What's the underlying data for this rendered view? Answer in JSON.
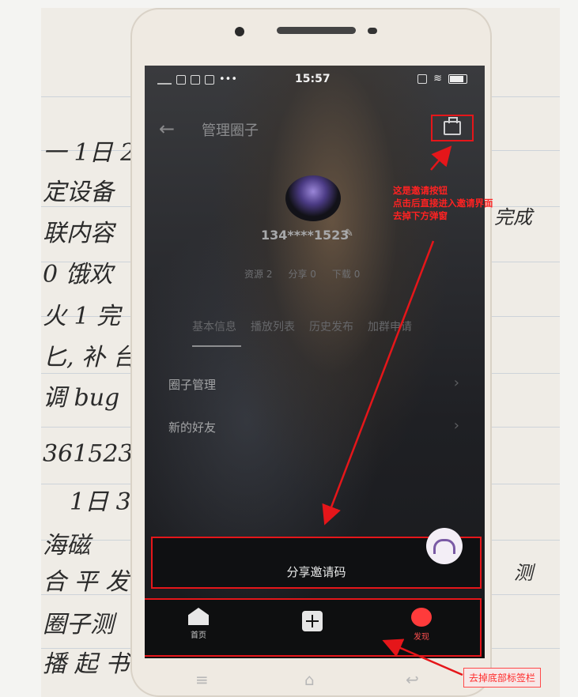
{
  "notes": {
    "lines": [
      "一 1日 2",
      "定设备",
      "联内容",
      "0 饿欢",
      "火 1 完",
      "匕, 补 台",
      "调 bug",
      "361523",
      "1日 3",
      "海磁",
      "合 平 发",
      "圈子测",
      "播 起 书",
      "完成",
      "测"
    ]
  },
  "status_bar": {
    "time": "15:57"
  },
  "app": {
    "back_icon": "←",
    "title": "管理圈子",
    "invite_icon": "invite-icon"
  },
  "profile": {
    "username": "134****1523",
    "edit_icon": "✎",
    "stats": {
      "resources": "资源 2",
      "shares": "分享 0",
      "downloads": "下载 0"
    }
  },
  "tabs": [
    "基本信息",
    "播放列表",
    "历史发布",
    "加群申请"
  ],
  "rows": [
    {
      "label": "圈子管理",
      "chevron": "›"
    },
    {
      "label": "新的好友",
      "chevron": "›"
    }
  ],
  "share": {
    "label": "分享邀请码"
  },
  "tabbar": {
    "items": [
      {
        "label": "首页"
      },
      {
        "label": ""
      },
      {
        "label": "发现"
      }
    ]
  },
  "annotations": {
    "invite_note": [
      "这是邀请按钮",
      "点击后直接进入邀请界面",
      "去掉下方弹窗"
    ],
    "bottom_note": "去掉底部标签栏"
  },
  "colors": {
    "annotation_red": "#e5161a"
  }
}
